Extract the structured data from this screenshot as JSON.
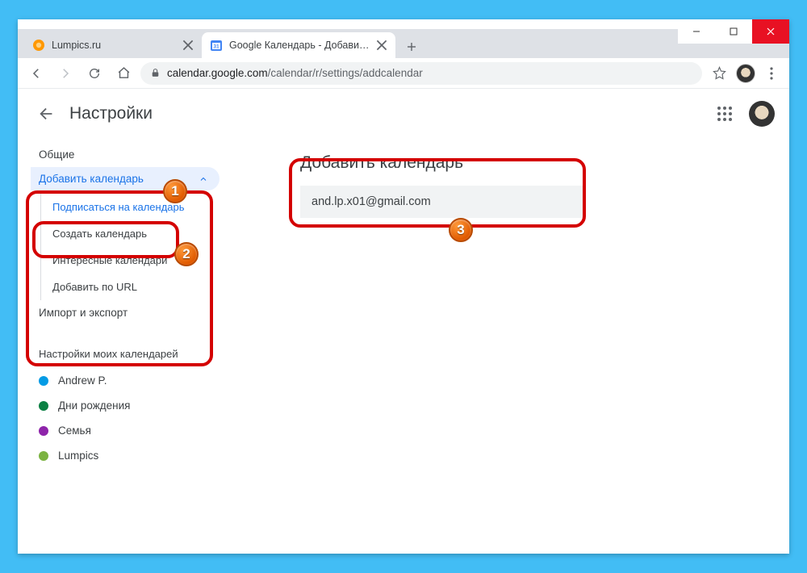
{
  "window": {
    "minimize": "—",
    "maximize": "▢",
    "close": "✕"
  },
  "tabs": [
    {
      "label": "Lumpics.ru",
      "active": false
    },
    {
      "label": "Google Календарь - Добавить к",
      "active": true
    }
  ],
  "addr": {
    "domain": "calendar.google.com",
    "path": "/calendar/r/settings/addcalendar"
  },
  "app": {
    "title": "Настройки"
  },
  "sidebar": {
    "general": "Общие",
    "add_cal": "Добавить календарь",
    "sub": {
      "subscribe": "Подписаться на календарь",
      "create": "Создать календарь",
      "interesting": "Интересные календари",
      "byurl": "Добавить по URL"
    },
    "impexp": "Импорт и экспорт",
    "mycals_hdr": "Настройки моих календарей",
    "cals": [
      {
        "name": "Andrew P.",
        "color": "#039be5"
      },
      {
        "name": "Дни рождения",
        "color": "#0b8043"
      },
      {
        "name": "Семья",
        "color": "#8e24aa"
      },
      {
        "name": "Lumpics",
        "color": "#7cb342"
      }
    ]
  },
  "main": {
    "title": "Добавить календарь",
    "email": "and.lp.x01@gmail.com"
  },
  "badges": {
    "b1": "1",
    "b2": "2",
    "b3": "3"
  }
}
